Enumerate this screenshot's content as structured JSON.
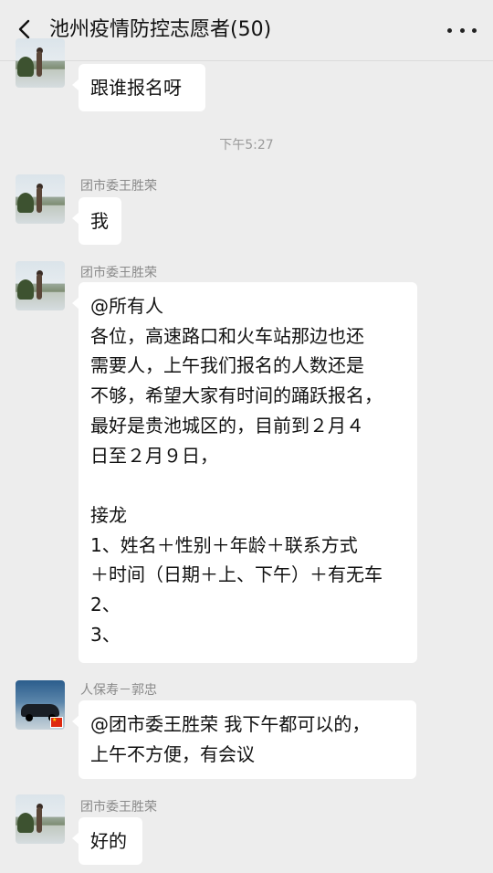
{
  "header": {
    "title": "池州疫情防控志愿者(50)",
    "back_icon": "chevron-left-icon",
    "more_icon": "more-dots-icon"
  },
  "timestamp": "下午5:27",
  "messages": [
    {
      "sender": "",
      "lines": [
        "跟谁报名呀"
      ]
    },
    {
      "sender": "团市委王胜荣",
      "lines": [
        "我"
      ]
    },
    {
      "sender": "团市委王胜荣",
      "lines": [
        "@所有人",
        "各位，高速路口和火车站那边也还",
        "需要人，上午我们报名的人数还是",
        "不够，希望大家有时间的踊跃报名，",
        "最好是贵池城区的，目前到２月４",
        "日至２月９日，",
        "",
        "接龙",
        "1、姓名＋性别＋年龄＋联系方式",
        "＋时间（日期＋上、下午）＋有无车",
        "2、",
        "3、"
      ]
    },
    {
      "sender": "人保寿－郭忠",
      "lines": [
        "@团市委王胜荣  我下午都可以的，",
        "上午不方便，有会议"
      ]
    },
    {
      "sender": "团市委王胜荣",
      "lines": [
        "好的"
      ]
    }
  ]
}
